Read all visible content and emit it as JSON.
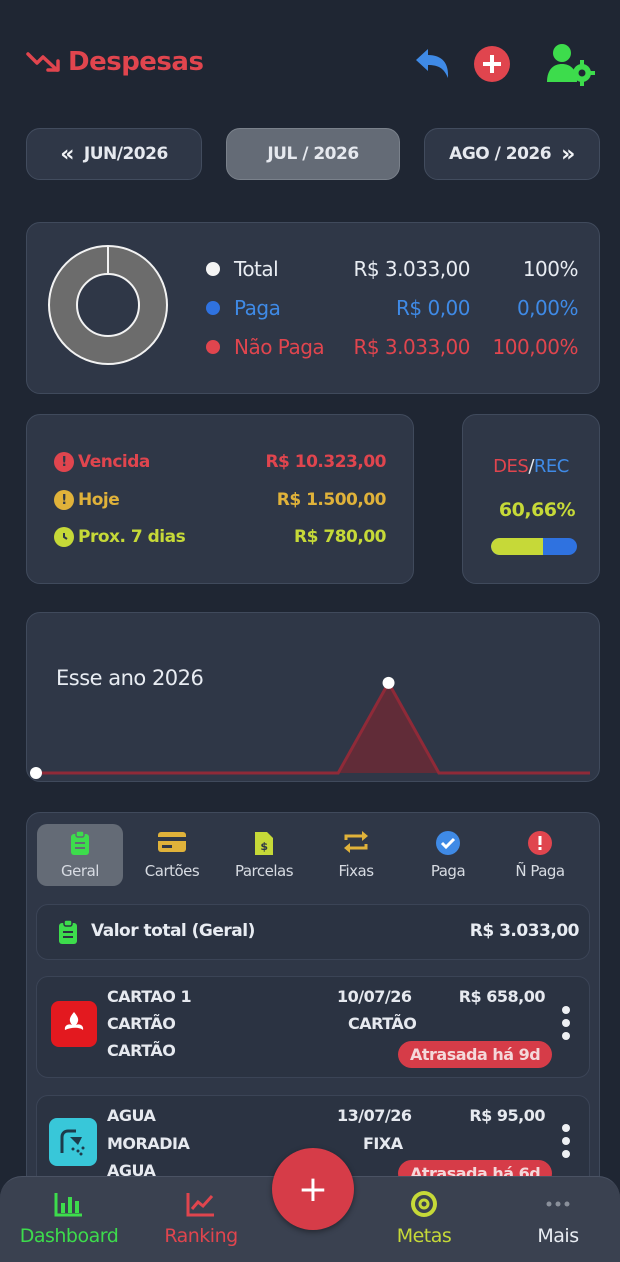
{
  "header": {
    "title": "Despesas",
    "icons": [
      "trending-down-icon",
      "undo-icon",
      "add-circle-icon",
      "user-settings-icon"
    ]
  },
  "months": {
    "prev": "JUN/2026",
    "current": "JUL / 2026",
    "next": "AGO / 2026"
  },
  "summary": {
    "total_label": "Total",
    "total_value": "R$ 3.033,00",
    "total_pct": "100%",
    "paid_label": "Paga",
    "paid_value": "R$ 0,00",
    "paid_pct": "0,00%",
    "unpaid_label": "Não Paga",
    "unpaid_value": "R$ 3.033,00",
    "unpaid_pct": "100,00%",
    "paid_fraction": 0.0
  },
  "due": {
    "overdue_label": "Vencida",
    "overdue_value": "R$ 10.323,00",
    "today_label": "Hoje",
    "today_value": "R$ 1.500,00",
    "next7_label": "Prox. 7 dias",
    "next7_value": "R$ 780,00"
  },
  "ratio": {
    "des_label": "DES",
    "separator": "/",
    "rec_label": "REC",
    "value": "60,66%",
    "fraction": 0.6066
  },
  "year_chart": {
    "title": "Esse ano 2026"
  },
  "chart_data": {
    "type": "area",
    "title": "Esse ano 2026",
    "x": [
      1,
      2,
      3,
      4,
      5,
      6,
      7,
      8,
      9,
      10,
      11,
      12
    ],
    "values": [
      0,
      0,
      0,
      0,
      0,
      0,
      0,
      3033,
      0,
      0,
      0,
      0
    ],
    "ylim": [
      0,
      3500
    ],
    "grid": false
  },
  "tabs": [
    {
      "label": "Geral",
      "icon": "clipboard-icon"
    },
    {
      "label": "Cartões",
      "icon": "credit-card-icon"
    },
    {
      "label": "Parcelas",
      "icon": "installments-icon"
    },
    {
      "label": "Fixas",
      "icon": "repeat-icon"
    },
    {
      "label": "Paga",
      "icon": "check-badge-icon"
    },
    {
      "label": "Ñ Paga",
      "icon": "alert-icon"
    }
  ],
  "total_row": {
    "label": "Valor total (Geral)",
    "value": "R$ 3.033,00"
  },
  "items": [
    {
      "line1": "CARTAO 1",
      "line2": "CARTÃO",
      "line3": "CARTÃO",
      "date": "10/07/26",
      "value": "R$ 658,00",
      "type": "CARTÃO",
      "badge": "Atrasada há 9d",
      "icon": "bank-santander-icon"
    },
    {
      "line1": "AGUA",
      "line2": "MORADIA",
      "line3": "AGUA",
      "date": "13/07/26",
      "value": "R$ 95,00",
      "type": "FIXA",
      "badge": "Atrasada há 6d",
      "icon": "shower-icon"
    }
  ],
  "nav": {
    "dashboard": "Dashboard",
    "ranking": "Ranking",
    "add": "+",
    "metas": "Metas",
    "mais": "Mais"
  },
  "colors": {
    "background": "#1f2633",
    "card": "#2f3747",
    "red": "#e0454e",
    "blue": "#3f8ae6",
    "yellow": "#e0b23a",
    "lime": "#c6d938",
    "green": "#3ddc4c"
  }
}
